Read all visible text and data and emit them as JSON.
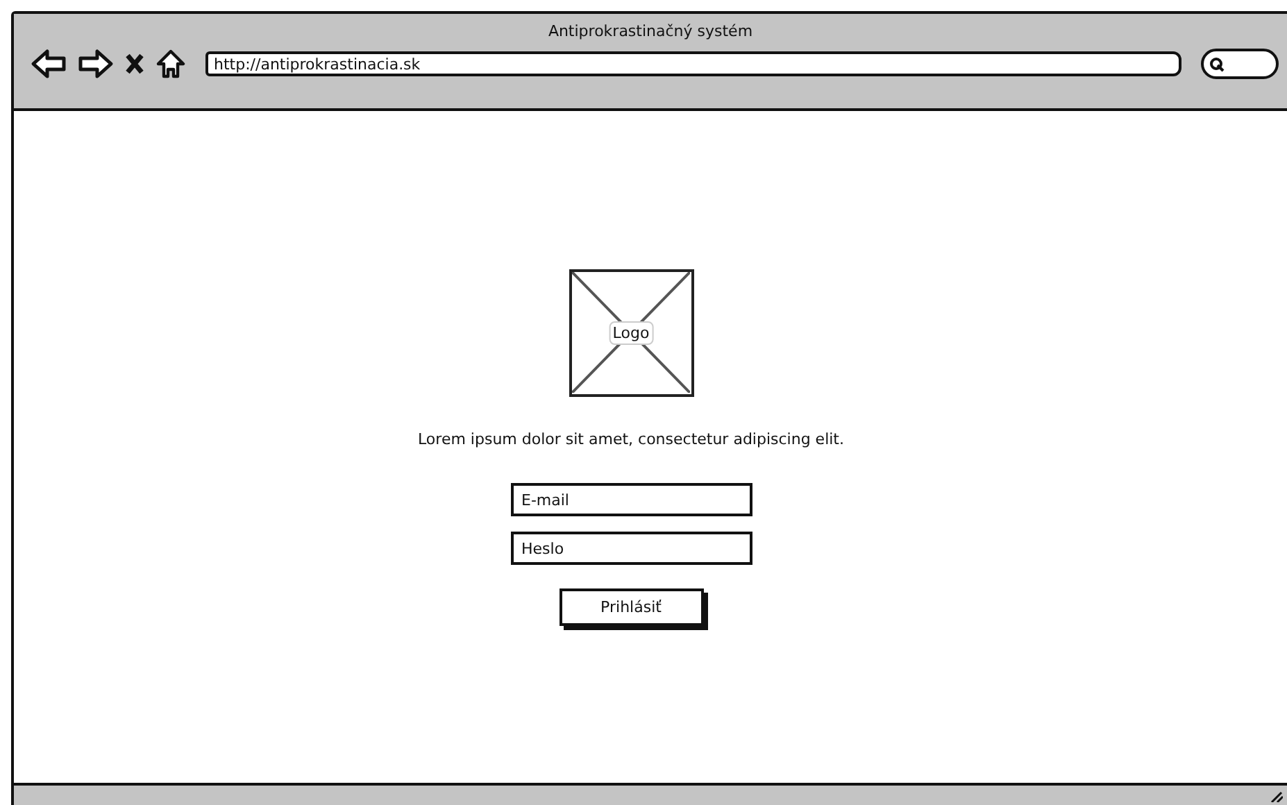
{
  "window": {
    "title": "Antiprokrastinačný systém",
    "url": "http://antiprokrastinacia.sk"
  },
  "login": {
    "logo_label": "Logo",
    "text": "Lorem ipsum dolor sit amet, consectetur adipiscing elit.",
    "fields": [
      {
        "placeholder": "E-mail"
      },
      {
        "placeholder": "Heslo"
      }
    ],
    "button": "Prihlásiť"
  }
}
